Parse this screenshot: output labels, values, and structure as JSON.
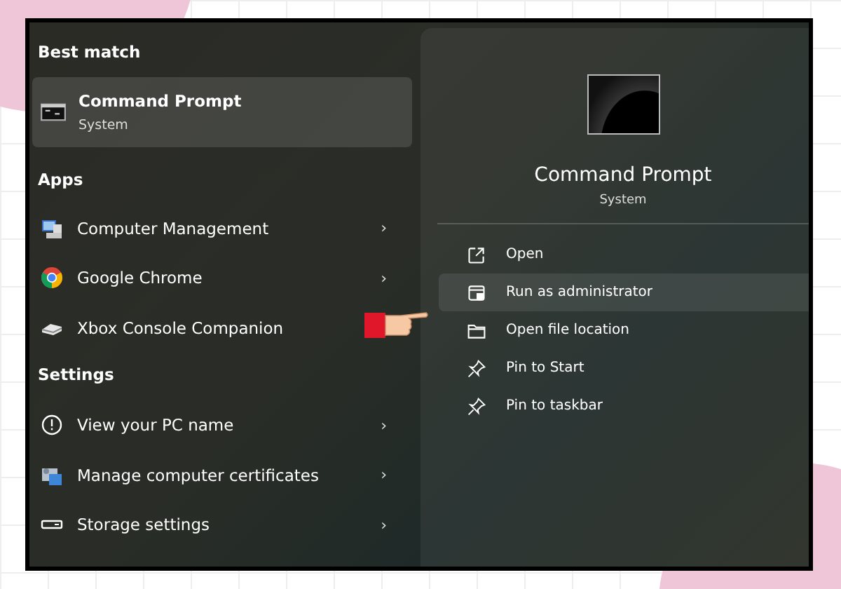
{
  "best_match": {
    "heading": "Best match",
    "item": {
      "title": "Command Prompt",
      "subtitle": "System",
      "selected": true
    }
  },
  "apps": {
    "heading": "Apps",
    "items": [
      {
        "label": "Computer Management",
        "kind": "management",
        "arrow": "›"
      },
      {
        "label": "Google Chrome",
        "kind": "chrome",
        "arrow": "›"
      },
      {
        "label": "Xbox Console Companion",
        "kind": "console"
      }
    ]
  },
  "settings": {
    "heading": "Settings",
    "items": [
      {
        "label": "View your PC name",
        "kind": "info",
        "arrow": "›"
      },
      {
        "label": "Manage computer certificates",
        "kind": "certificates",
        "arrow": "›"
      },
      {
        "label": "Storage settings",
        "kind": "storage",
        "arrow": "›"
      }
    ]
  },
  "details": {
    "title": "Command Prompt",
    "subtitle": "System",
    "actions": [
      {
        "label": "Open",
        "kind": "open",
        "selected": false
      },
      {
        "label": "Run as administrator",
        "kind": "admin",
        "selected": true
      },
      {
        "label": "Open file location",
        "kind": "folder",
        "selected": false
      },
      {
        "label": "Pin to Start",
        "kind": "pin",
        "selected": false
      },
      {
        "label": "Pin to taskbar",
        "kind": "pin",
        "selected": false
      }
    ]
  }
}
